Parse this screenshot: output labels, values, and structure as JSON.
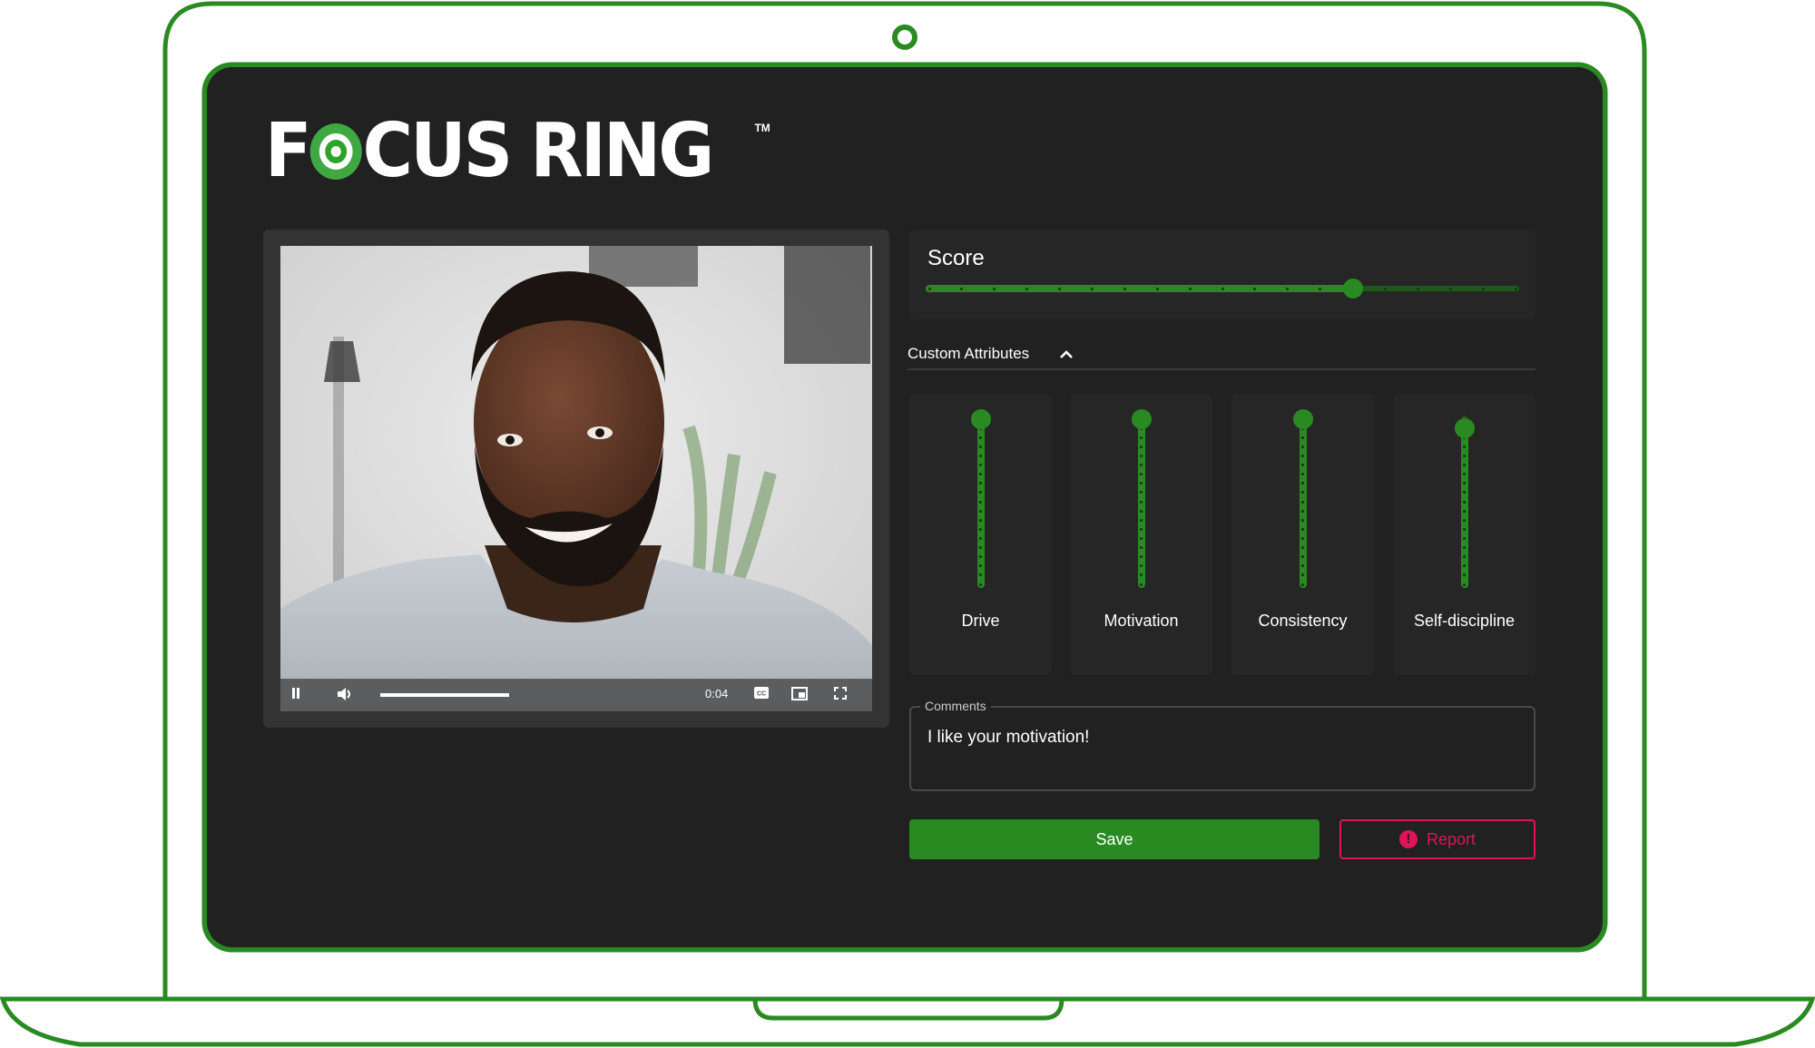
{
  "brand": {
    "name_part1": "F",
    "name_part2": "CUS",
    "name_part3": "RING",
    "trademark": "TM",
    "accent_color": "#2a8a22",
    "danger_color": "#e0135a"
  },
  "video": {
    "current_time": "0:04",
    "progress_fraction": 1.0,
    "controls": {
      "pause": "pause-icon",
      "volume": "volume-icon",
      "captions": "closed-captions-icon",
      "picture_in_picture": "picture-in-picture-icon",
      "fullscreen": "fullscreen-icon"
    }
  },
  "score": {
    "label": "Score",
    "value": 13,
    "max": 18,
    "step_count": 18
  },
  "custom_attributes": {
    "title": "Custom Attributes",
    "expanded": true,
    "items": [
      {
        "label": "Drive",
        "value": 18,
        "max": 18
      },
      {
        "label": "Motivation",
        "value": 18,
        "max": 18
      },
      {
        "label": "Consistency",
        "value": 18,
        "max": 18
      },
      {
        "label": "Self-discipline",
        "value": 17,
        "max": 18
      }
    ]
  },
  "comments": {
    "label": "Comments",
    "value": "I like your motivation!"
  },
  "actions": {
    "save_label": "Save",
    "report_label": "Report",
    "report_icon": "alert-circle-icon"
  }
}
